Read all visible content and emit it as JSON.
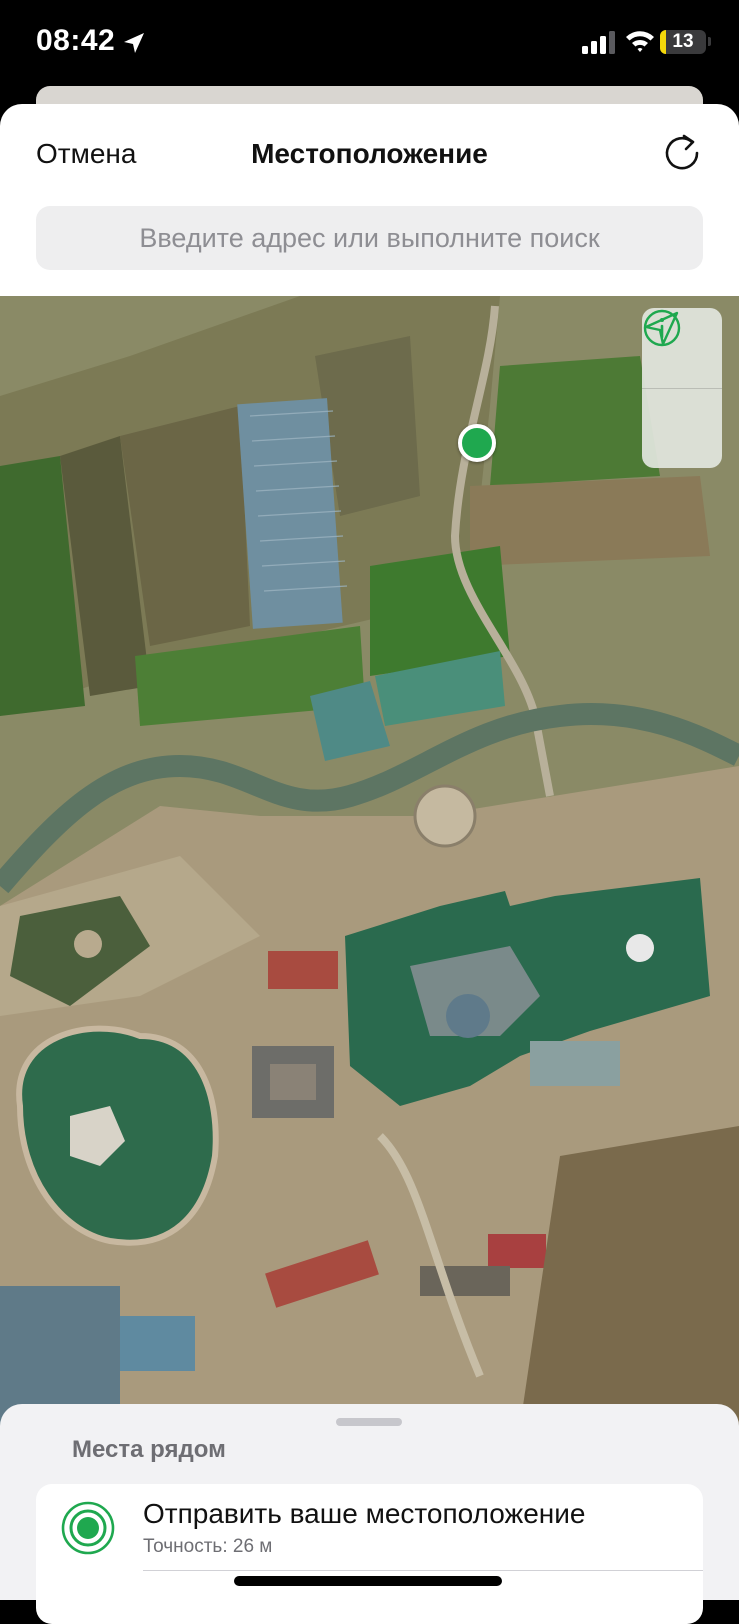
{
  "status_bar": {
    "time": "08:42",
    "battery_percent": "13",
    "battery_level": 0.13,
    "location_icon": "location-arrow-icon",
    "signal_icon": "cellular-signal-icon",
    "wifi_icon": "wifi-icon",
    "battery_icon": "battery-icon"
  },
  "nav": {
    "cancel_label": "Отмена",
    "title": "Местоположение",
    "refresh_icon": "refresh-icon"
  },
  "search": {
    "placeholder": "Введите адрес или выполните поиск"
  },
  "map": {
    "type": "satellite",
    "controls": [
      "info-icon",
      "navigation-arrow-icon"
    ],
    "pin_color": "#1fa84f"
  },
  "nearby": {
    "title": "Места рядом",
    "send_location_label": "Отправить ваше местоположение",
    "accuracy_text": "Точность: 26 м",
    "accent_color": "#1fa84f"
  }
}
